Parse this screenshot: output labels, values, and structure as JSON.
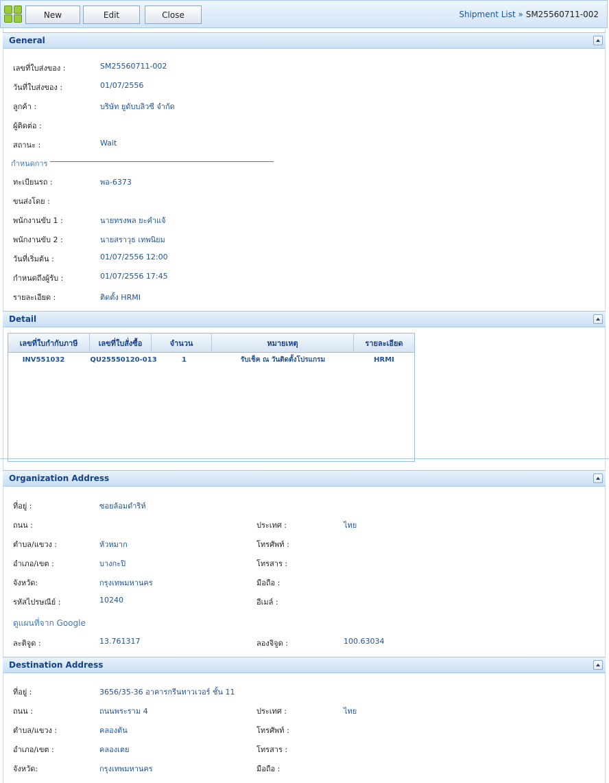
{
  "toolbar": {
    "new_label": "New",
    "edit_label": "Edit",
    "close_label": "Close"
  },
  "breadcrumb": {
    "parent": "Shipment List",
    "separator": "»",
    "current": "SM25560711-002"
  },
  "general": {
    "title": "General",
    "fields": [
      {
        "label": "เลขที่ใบส่งของ :",
        "value": "SM25560711-002"
      },
      {
        "label": "วันที่ใบส่งของ :",
        "value": "01/07/2556"
      },
      {
        "label": "ลูกค้า :",
        "value": "บริษัท ยูดับบลิวซี จำกัด"
      },
      {
        "label": "ผู้ติดต่อ :",
        "value": ""
      },
      {
        "label": "สถานะ :",
        "value": "Wait"
      }
    ],
    "schedule_legend": "กำหนดการ",
    "schedule_fields": [
      {
        "label": "ทะเบียนรถ :",
        "value": "พอ-6373"
      },
      {
        "label": "ขนส่งโดย :",
        "value": ""
      },
      {
        "label": "พนักงานขับ 1 :",
        "value": "นายทรงพล ยะคำแจ้"
      },
      {
        "label": "พนักงานขับ 2 :",
        "value": "นายสราวุธ เทพนิยม"
      },
      {
        "label": "วันที่เริ่มต้น :",
        "value": "01/07/2556 12:00"
      },
      {
        "label": "กำหนดถึงผู้รับ :",
        "value": "01/07/2556 17:45"
      },
      {
        "label": "รายละเอียด :",
        "value": "ติดตั้ง HRMI"
      }
    ]
  },
  "detail": {
    "title": "Detail",
    "columns": [
      "เลขที่ใบกำกับภาษี",
      "เลขที่ใบสั่งซื้อ",
      "จำนวน",
      "หมายเหตุ",
      "รายละเอียด"
    ],
    "rows": [
      [
        "INV551032",
        "QU25550120-013",
        "1",
        "รับเช็ค ณ วันติดตั้งโปรแกรม",
        "HRMI"
      ]
    ]
  },
  "org_address": {
    "title": "Organization Address",
    "left": [
      {
        "label": "ที่อยู่ :",
        "value": "ซอยล้อมดำริห์"
      },
      {
        "label": "ถนน :",
        "value": ""
      },
      {
        "label": "ตำบล/แขวง :",
        "value": "หัวหมาก"
      },
      {
        "label": "อำเภอ/เขต :",
        "value": "บางกะปิ"
      },
      {
        "label": "จังหวัด:",
        "value": "กรุงเทพมหานคร"
      },
      {
        "label": "รหัสไปรษณีย์ :",
        "value": "10240"
      }
    ],
    "right": [
      {
        "label": "ประเทศ :",
        "value": "ไทย"
      },
      {
        "label": "โทรศัพท์ :",
        "value": ""
      },
      {
        "label": "โทรสาร :",
        "value": ""
      },
      {
        "label": "มือถือ :",
        "value": ""
      },
      {
        "label": "อีเมล์ :",
        "value": ""
      }
    ],
    "map_link": "ดูแผนที่จาก Google",
    "lat_label": "ละติจูด :",
    "lat_value": "13.761317",
    "lng_label": "ลองจิจูด :",
    "lng_value": "100.63034"
  },
  "dest_address": {
    "title": "Destination Address",
    "left": [
      {
        "label": "ที่อยู่ :",
        "value": "3656/35-36 อาคารกรีนทาวเวอร์ ชั้น 11"
      },
      {
        "label": "ถนน :",
        "value": "ถนนพระราม 4"
      },
      {
        "label": "ตำบล/แขวง :",
        "value": "คลองตัน"
      },
      {
        "label": "อำเภอ/เขต :",
        "value": "คลองเตย"
      },
      {
        "label": "จังหวัด:",
        "value": "กรุงเทพมหานคร"
      }
    ],
    "right": [
      {
        "label": "ประเทศ :",
        "value": "ไทย"
      },
      {
        "label": "โทรศัพท์ :",
        "value": ""
      },
      {
        "label": "โทรสาร :",
        "value": ""
      },
      {
        "label": "มือถือ :",
        "value": ""
      }
    ]
  }
}
